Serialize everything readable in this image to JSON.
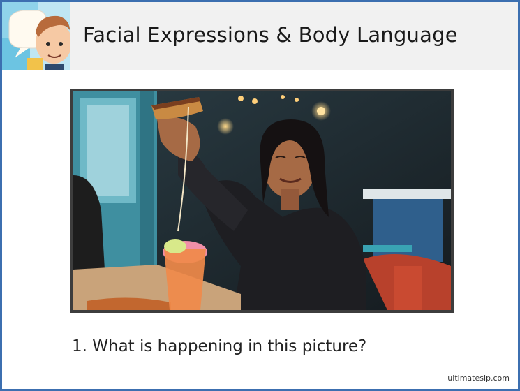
{
  "slide": {
    "title": "Facial Expressions & Body Language",
    "question": "1. What is happening in this picture?",
    "credit": "ultimateslp.com"
  },
  "photo": {
    "icon": "woman-eating-pizza-photo"
  },
  "logo": {
    "icon": "cartoon-boy-logo"
  },
  "colors": {
    "frame_border": "#3c6fb0",
    "header_band": "#f1f1f1",
    "photo_border": "#3d3d3d"
  }
}
